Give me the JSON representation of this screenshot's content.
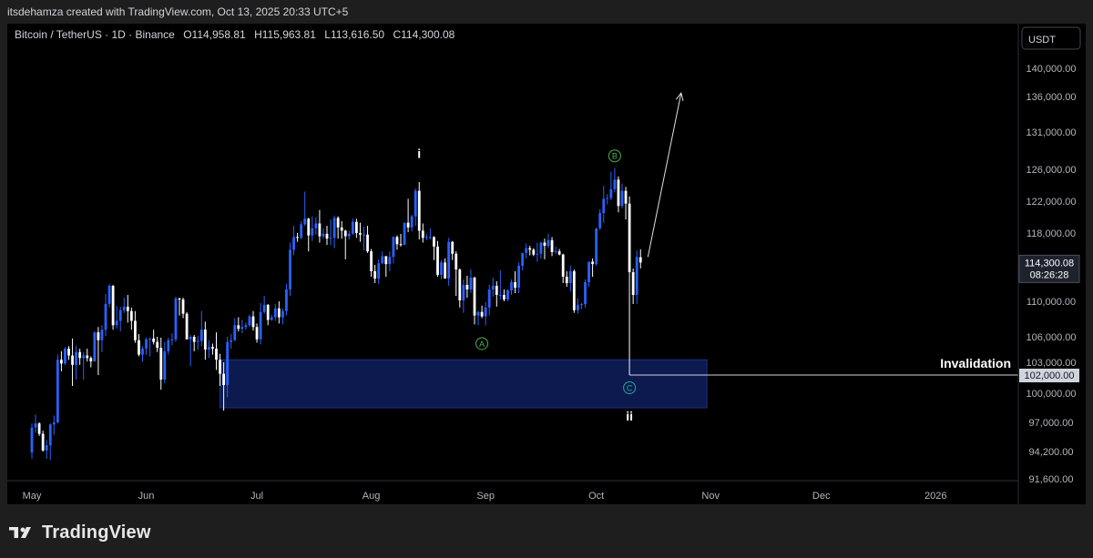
{
  "header": {
    "text": "itsdehamza created with TradingView.com, Oct 13, 2025 20:33 UTC+5"
  },
  "symbol": {
    "text": "Bitcoin / TetherUS · 1D · Binance",
    "open_label": "O",
    "open": "114,958.81",
    "high_label": "H",
    "high": "115,963.81",
    "low_label": "L",
    "low": "113,616.50",
    "close_label": "C",
    "close": "114,300.08"
  },
  "currency": "USDT",
  "brand": "TradingView",
  "colors": {
    "up": "#2962ff",
    "down": "#ffffff",
    "zone": "#0c1a4f",
    "wave_green": "#4caf50",
    "wave_teal": "#26a69a"
  },
  "chart_data": {
    "type": "candlestick",
    "x_ticks": [
      "May",
      "Jun",
      "Jul",
      "Aug",
      "Sep",
      "Oct",
      "Nov",
      "Dec",
      "2026"
    ],
    "y_ticks": [
      "91,600.00",
      "94,200.00",
      "97,000.00",
      "100,000.00",
      "103,000.00",
      "106,000.00",
      "110,000.00",
      "114,000.00",
      "118,000.00",
      "122,000.00",
      "126,000.00",
      "131,000.00",
      "136,000.00",
      "140,000.00"
    ],
    "last_price": "114,300.08",
    "countdown": "08:26:28",
    "invalidation_price": "102,000.00",
    "invalidation_label": "Invalidation",
    "demand_zone": {
      "start": "2025-06-21",
      "end": "2025-10-31",
      "low": 98500,
      "high": 103300
    },
    "wave_labels": [
      {
        "text": "i",
        "date": "2025-08-14",
        "price": 127500,
        "style": "plain"
      },
      {
        "text": "B",
        "date": "2025-10-06",
        "price": 127800,
        "style": "circle-green"
      },
      {
        "text": "A",
        "date": "2025-08-31",
        "price": 105200,
        "style": "circle-green"
      },
      {
        "text": "C",
        "date": "2025-10-10",
        "price": 100600,
        "style": "circle-teal"
      },
      {
        "text": "ii",
        "date": "2025-10-10",
        "price": 97200,
        "style": "plain"
      }
    ],
    "projection_arrow": {
      "from": {
        "date": "2025-10-15",
        "price": 115000
      },
      "to": {
        "date": "2025-10-24",
        "price": 136500
      }
    },
    "candles": [
      [
        "2025-05-01",
        94100,
        96900,
        93500,
        96500
      ],
      [
        "2025-05-02",
        96500,
        97800,
        96000,
        96900
      ],
      [
        "2025-05-03",
        96900,
        97000,
        95700,
        95900
      ],
      [
        "2025-05-04",
        95900,
        96200,
        94200,
        94300
      ],
      [
        "2025-05-05",
        94300,
        95300,
        93500,
        94800
      ],
      [
        "2025-05-06",
        94800,
        96900,
        93400,
        96800
      ],
      [
        "2025-05-07",
        96800,
        97700,
        95800,
        97000
      ],
      [
        "2025-05-08",
        97000,
        103900,
        96900,
        103300
      ],
      [
        "2025-05-09",
        103300,
        104300,
        102300,
        102900
      ],
      [
        "2025-05-10",
        102900,
        104800,
        102800,
        104600
      ],
      [
        "2025-05-11",
        104600,
        104900,
        103300,
        103800
      ],
      [
        "2025-05-12",
        103800,
        105800,
        100800,
        102800
      ],
      [
        "2025-05-13",
        102800,
        104900,
        101500,
        104200
      ],
      [
        "2025-05-14",
        104200,
        104600,
        102800,
        103500
      ],
      [
        "2025-05-15",
        103500,
        104200,
        101500,
        103800
      ],
      [
        "2025-05-16",
        103800,
        104600,
        103100,
        103500
      ],
      [
        "2025-05-17",
        103500,
        103700,
        102600,
        103100
      ],
      [
        "2025-05-18",
        103100,
        106600,
        103100,
        106500
      ],
      [
        "2025-05-19",
        106500,
        107100,
        102000,
        105600
      ],
      [
        "2025-05-20",
        105600,
        107300,
        104200,
        106800
      ],
      [
        "2025-05-21",
        106800,
        110800,
        106100,
        109700
      ],
      [
        "2025-05-22",
        109700,
        111900,
        109300,
        111700
      ],
      [
        "2025-05-23",
        111700,
        111800,
        106800,
        107300
      ],
      [
        "2025-05-24",
        107300,
        109500,
        106900,
        107800
      ],
      [
        "2025-05-25",
        107800,
        109400,
        106600,
        109000
      ],
      [
        "2025-05-26",
        109000,
        110400,
        108700,
        109400
      ],
      [
        "2025-05-27",
        109400,
        110700,
        107600,
        108900
      ],
      [
        "2025-05-28",
        108900,
        109300,
        106800,
        107800
      ],
      [
        "2025-05-29",
        107800,
        108900,
        105300,
        105600
      ],
      [
        "2025-05-30",
        105600,
        106300,
        103700,
        103900
      ],
      [
        "2025-05-31",
        103900,
        104900,
        103100,
        104600
      ],
      [
        "2025-06-01",
        104600,
        105900,
        103900,
        105700
      ],
      [
        "2025-06-02",
        105700,
        105900,
        103700,
        105800
      ],
      [
        "2025-06-03",
        105800,
        106800,
        105100,
        105400
      ],
      [
        "2025-06-04",
        105400,
        106000,
        104200,
        104700
      ],
      [
        "2025-06-05",
        104700,
        105900,
        100400,
        101500
      ],
      [
        "2025-06-06",
        101500,
        105400,
        101100,
        104300
      ],
      [
        "2025-06-07",
        104300,
        105900,
        103900,
        105600
      ],
      [
        "2025-06-08",
        105600,
        106400,
        105000,
        105700
      ],
      [
        "2025-06-09",
        105700,
        110500,
        105400,
        110300
      ],
      [
        "2025-06-10",
        110300,
        110400,
        108400,
        110200
      ],
      [
        "2025-06-11",
        110200,
        110400,
        108100,
        108600
      ],
      [
        "2025-06-12",
        108600,
        108800,
        105700,
        105700
      ],
      [
        "2025-06-13",
        105700,
        106200,
        102700,
        106000
      ],
      [
        "2025-06-14",
        106000,
        106200,
        104300,
        105400
      ],
      [
        "2025-06-15",
        105400,
        106100,
        104500,
        105500
      ],
      [
        "2025-06-16",
        105500,
        108900,
        104900,
        106800
      ],
      [
        "2025-06-17",
        106800,
        107700,
        103300,
        104500
      ],
      [
        "2025-06-18",
        104500,
        105600,
        103500,
        104800
      ],
      [
        "2025-06-19",
        104800,
        105200,
        103900,
        104600
      ],
      [
        "2025-06-20",
        104600,
        106500,
        102400,
        103300
      ],
      [
        "2025-06-21",
        103300,
        104000,
        100800,
        102100
      ],
      [
        "2025-06-22",
        102100,
        103000,
        98200,
        100900
      ],
      [
        "2025-06-23",
        100900,
        106000,
        99600,
        105400
      ],
      [
        "2025-06-24",
        105400,
        106300,
        104600,
        105600
      ],
      [
        "2025-06-25",
        105600,
        108100,
        105500,
        107300
      ],
      [
        "2025-06-26",
        107300,
        108200,
        106600,
        106900
      ],
      [
        "2025-06-27",
        106900,
        107900,
        106400,
        107100
      ],
      [
        "2025-06-28",
        107100,
        107600,
        106800,
        107300
      ],
      [
        "2025-06-29",
        107300,
        108500,
        107100,
        108300
      ],
      [
        "2025-06-30",
        108300,
        108900,
        106700,
        107100
      ],
      [
        "2025-07-01",
        107100,
        107500,
        105300,
        105700
      ],
      [
        "2025-07-02",
        105700,
        109800,
        105100,
        108800
      ],
      [
        "2025-07-03",
        108800,
        110600,
        108600,
        109600
      ],
      [
        "2025-07-04",
        109600,
        109700,
        107300,
        107900
      ],
      [
        "2025-07-05",
        107900,
        108500,
        107800,
        108200
      ],
      [
        "2025-07-06",
        108200,
        109700,
        107800,
        109200
      ],
      [
        "2025-07-07",
        109200,
        110000,
        107500,
        108200
      ],
      [
        "2025-07-08",
        108200,
        109200,
        107400,
        108900
      ],
      [
        "2025-07-09",
        108900,
        111900,
        108400,
        111300
      ],
      [
        "2025-07-10",
        111300,
        116800,
        110600,
        115900
      ],
      [
        "2025-07-11",
        115900,
        118900,
        115200,
        117500
      ],
      [
        "2025-07-12",
        117500,
        118000,
        116900,
        117400
      ],
      [
        "2025-07-13",
        117400,
        119500,
        117200,
        119100
      ],
      [
        "2025-07-14",
        119100,
        123200,
        118900,
        119800
      ],
      [
        "2025-07-15",
        119800,
        119900,
        115700,
        117700
      ],
      [
        "2025-07-16",
        117700,
        120100,
        117000,
        118600
      ],
      [
        "2025-07-17",
        118600,
        120000,
        117800,
        119200
      ],
      [
        "2025-07-18",
        119200,
        120900,
        116800,
        117600
      ],
      [
        "2025-07-19",
        117600,
        118600,
        117300,
        117900
      ],
      [
        "2025-07-20",
        117900,
        118900,
        116500,
        117300
      ],
      [
        "2025-07-21",
        117300,
        119700,
        116500,
        117400
      ],
      [
        "2025-07-22",
        117400,
        120200,
        116100,
        119900
      ],
      [
        "2025-07-23",
        119900,
        120100,
        117300,
        118700
      ],
      [
        "2025-07-24",
        118700,
        119500,
        117300,
        118300
      ],
      [
        "2025-07-25",
        118300,
        118400,
        114700,
        117600
      ],
      [
        "2025-07-26",
        117600,
        118300,
        117200,
        117900
      ],
      [
        "2025-07-27",
        117900,
        119800,
        117800,
        119400
      ],
      [
        "2025-07-28",
        119400,
        119800,
        117400,
        118000
      ],
      [
        "2025-07-29",
        118000,
        119300,
        116900,
        117800
      ],
      [
        "2025-07-30",
        117800,
        118800,
        115800,
        117800
      ],
      [
        "2025-07-31",
        117800,
        118900,
        115500,
        115700
      ],
      [
        "2025-08-01",
        115700,
        116000,
        112700,
        113300
      ],
      [
        "2025-08-02",
        113300,
        114000,
        112000,
        112500
      ],
      [
        "2025-08-03",
        112500,
        114700,
        111900,
        114200
      ],
      [
        "2025-08-04",
        114200,
        115700,
        114100,
        115100
      ],
      [
        "2025-08-05",
        115100,
        115100,
        112700,
        114100
      ],
      [
        "2025-08-06",
        114100,
        115700,
        113300,
        115000
      ],
      [
        "2025-08-07",
        115000,
        117600,
        114200,
        117500
      ],
      [
        "2025-08-08",
        117500,
        117700,
        115900,
        116600
      ],
      [
        "2025-08-09",
        116600,
        117900,
        116300,
        116500
      ],
      [
        "2025-08-10",
        116500,
        119300,
        116500,
        119300
      ],
      [
        "2025-08-11",
        119300,
        122300,
        118100,
        118700
      ],
      [
        "2025-08-12",
        118700,
        120300,
        118200,
        120100
      ],
      [
        "2025-08-13",
        120100,
        123600,
        118900,
        123300
      ],
      [
        "2025-08-14",
        123300,
        124400,
        117200,
        118300
      ],
      [
        "2025-08-15",
        118300,
        119200,
        116800,
        117400
      ],
      [
        "2025-08-16",
        117400,
        117900,
        117100,
        117500
      ],
      [
        "2025-08-17",
        117500,
        118600,
        117200,
        117500
      ],
      [
        "2025-08-18",
        117500,
        117600,
        114600,
        116300
      ],
      [
        "2025-08-19",
        116300,
        117000,
        112700,
        112900
      ],
      [
        "2025-08-20",
        112900,
        114600,
        112400,
        114300
      ],
      [
        "2025-08-21",
        114300,
        114800,
        112600,
        112500
      ],
      [
        "2025-08-22",
        112500,
        117400,
        111700,
        116900
      ],
      [
        "2025-08-23",
        116900,
        117000,
        114600,
        115400
      ],
      [
        "2025-08-24",
        115400,
        115700,
        110600,
        113500
      ],
      [
        "2025-08-25",
        113500,
        113600,
        109300,
        110100
      ],
      [
        "2025-08-26",
        110100,
        112400,
        108700,
        111800
      ],
      [
        "2025-08-27",
        111800,
        112800,
        110400,
        111300
      ],
      [
        "2025-08-28",
        111300,
        113500,
        110900,
        112600
      ],
      [
        "2025-08-29",
        112600,
        112700,
        107400,
        108400
      ],
      [
        "2025-08-30",
        108400,
        108900,
        107300,
        108800
      ],
      [
        "2025-08-31",
        108800,
        109500,
        108100,
        108300
      ],
      [
        "2025-09-01",
        108300,
        109900,
        107300,
        109300
      ],
      [
        "2025-09-02",
        109300,
        111800,
        108400,
        111300
      ],
      [
        "2025-09-03",
        111300,
        112600,
        110500,
        111700
      ],
      [
        "2025-09-04",
        111700,
        112200,
        109400,
        110700
      ],
      [
        "2025-09-05",
        110700,
        113400,
        110200,
        110700
      ],
      [
        "2025-09-06",
        110700,
        111300,
        110000,
        110200
      ],
      [
        "2025-09-07",
        110200,
        111300,
        110000,
        111200
      ],
      [
        "2025-09-08",
        111200,
        112400,
        110700,
        112100
      ],
      [
        "2025-09-09",
        112100,
        113300,
        110900,
        111500
      ],
      [
        "2025-09-10",
        111500,
        114300,
        110900,
        113900
      ],
      [
        "2025-09-11",
        113900,
        115500,
        113400,
        115500
      ],
      [
        "2025-09-12",
        115500,
        116700,
        114800,
        116100
      ],
      [
        "2025-09-13",
        116100,
        116400,
        115200,
        115900
      ],
      [
        "2025-09-14",
        115900,
        116100,
        115100,
        115300
      ],
      [
        "2025-09-15",
        115300,
        116800,
        114400,
        115400
      ],
      [
        "2025-09-16",
        115400,
        116900,
        114800,
        116800
      ],
      [
        "2025-09-17",
        116800,
        117300,
        114700,
        116400
      ],
      [
        "2025-09-18",
        116400,
        117900,
        116100,
        117100
      ],
      [
        "2025-09-19",
        117100,
        117500,
        115100,
        115600
      ],
      [
        "2025-09-20",
        115600,
        116300,
        115400,
        115700
      ],
      [
        "2025-09-21",
        115700,
        116000,
        115200,
        115300
      ],
      [
        "2025-09-22",
        115300,
        115400,
        112000,
        112700
      ],
      [
        "2025-09-23",
        112700,
        113300,
        111600,
        112000
      ],
      [
        "2025-09-24",
        112000,
        113900,
        111100,
        113300
      ],
      [
        "2025-09-25",
        113300,
        113500,
        108700,
        109000
      ],
      [
        "2025-09-26",
        109000,
        110300,
        108600,
        109600
      ],
      [
        "2025-09-27",
        109600,
        109800,
        109100,
        109700
      ],
      [
        "2025-09-28",
        109700,
        112400,
        109300,
        112100
      ],
      [
        "2025-09-29",
        112100,
        114400,
        111600,
        114400
      ],
      [
        "2025-09-30",
        114400,
        114800,
        112700,
        114100
      ],
      [
        "2025-10-01",
        114100,
        118600,
        113900,
        118600
      ],
      [
        "2025-10-02",
        118600,
        121000,
        118400,
        120500
      ],
      [
        "2025-10-03",
        120500,
        123900,
        119300,
        122300
      ],
      [
        "2025-10-04",
        122300,
        122900,
        121600,
        122400
      ],
      [
        "2025-10-05",
        122400,
        125700,
        122100,
        123500
      ],
      [
        "2025-10-06",
        123500,
        126200,
        123100,
        124700
      ],
      [
        "2025-10-07",
        124700,
        125100,
        120600,
        121400
      ],
      [
        "2025-10-08",
        121400,
        124200,
        121100,
        123300
      ],
      [
        "2025-10-09",
        123300,
        123800,
        119700,
        121700
      ],
      [
        "2025-10-10",
        121700,
        122600,
        102000,
        113200
      ],
      [
        "2025-10-11",
        113200,
        113600,
        109700,
        110700
      ],
      [
        "2025-10-12",
        110700,
        115800,
        109700,
        115000
      ],
      [
        "2025-10-13",
        114958.81,
        115963.81,
        113616.5,
        114300.08
      ]
    ]
  }
}
